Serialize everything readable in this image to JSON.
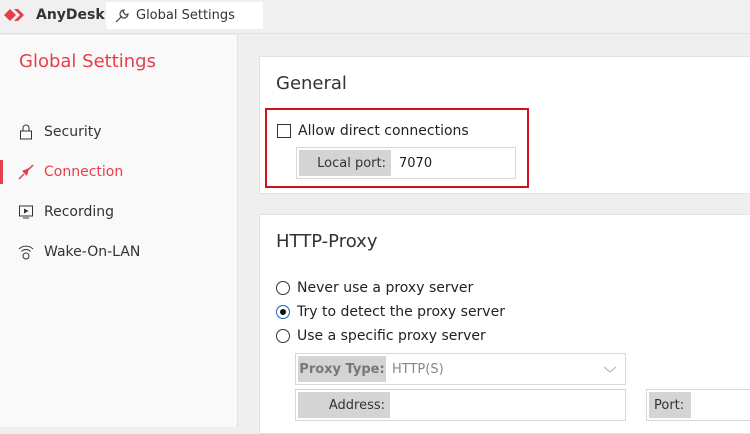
{
  "app": {
    "name": "AnyDesk",
    "tab_label": "Global Settings"
  },
  "sidebar": {
    "title": "Global Settings",
    "items": [
      {
        "label": "Security"
      },
      {
        "label": "Connection"
      },
      {
        "label": "Recording"
      },
      {
        "label": "Wake-On-LAN"
      }
    ]
  },
  "general": {
    "title": "General",
    "allow_direct": "Allow direct connections",
    "allow_direct_checked": false,
    "local_port_label": "Local port:",
    "local_port_value": "7070"
  },
  "proxy": {
    "title": "HTTP-Proxy",
    "options": [
      "Never use a proxy server",
      "Try to detect the proxy server",
      "Use a specific proxy server"
    ],
    "selected": 1,
    "type_label": "Proxy Type:",
    "type_value": "HTTP(S)",
    "address_label": "Address:",
    "address_value": "",
    "port_label": "Port:",
    "port_value": ""
  },
  "colors": {
    "accent": "#e5404a",
    "highlight": "#d01020"
  }
}
